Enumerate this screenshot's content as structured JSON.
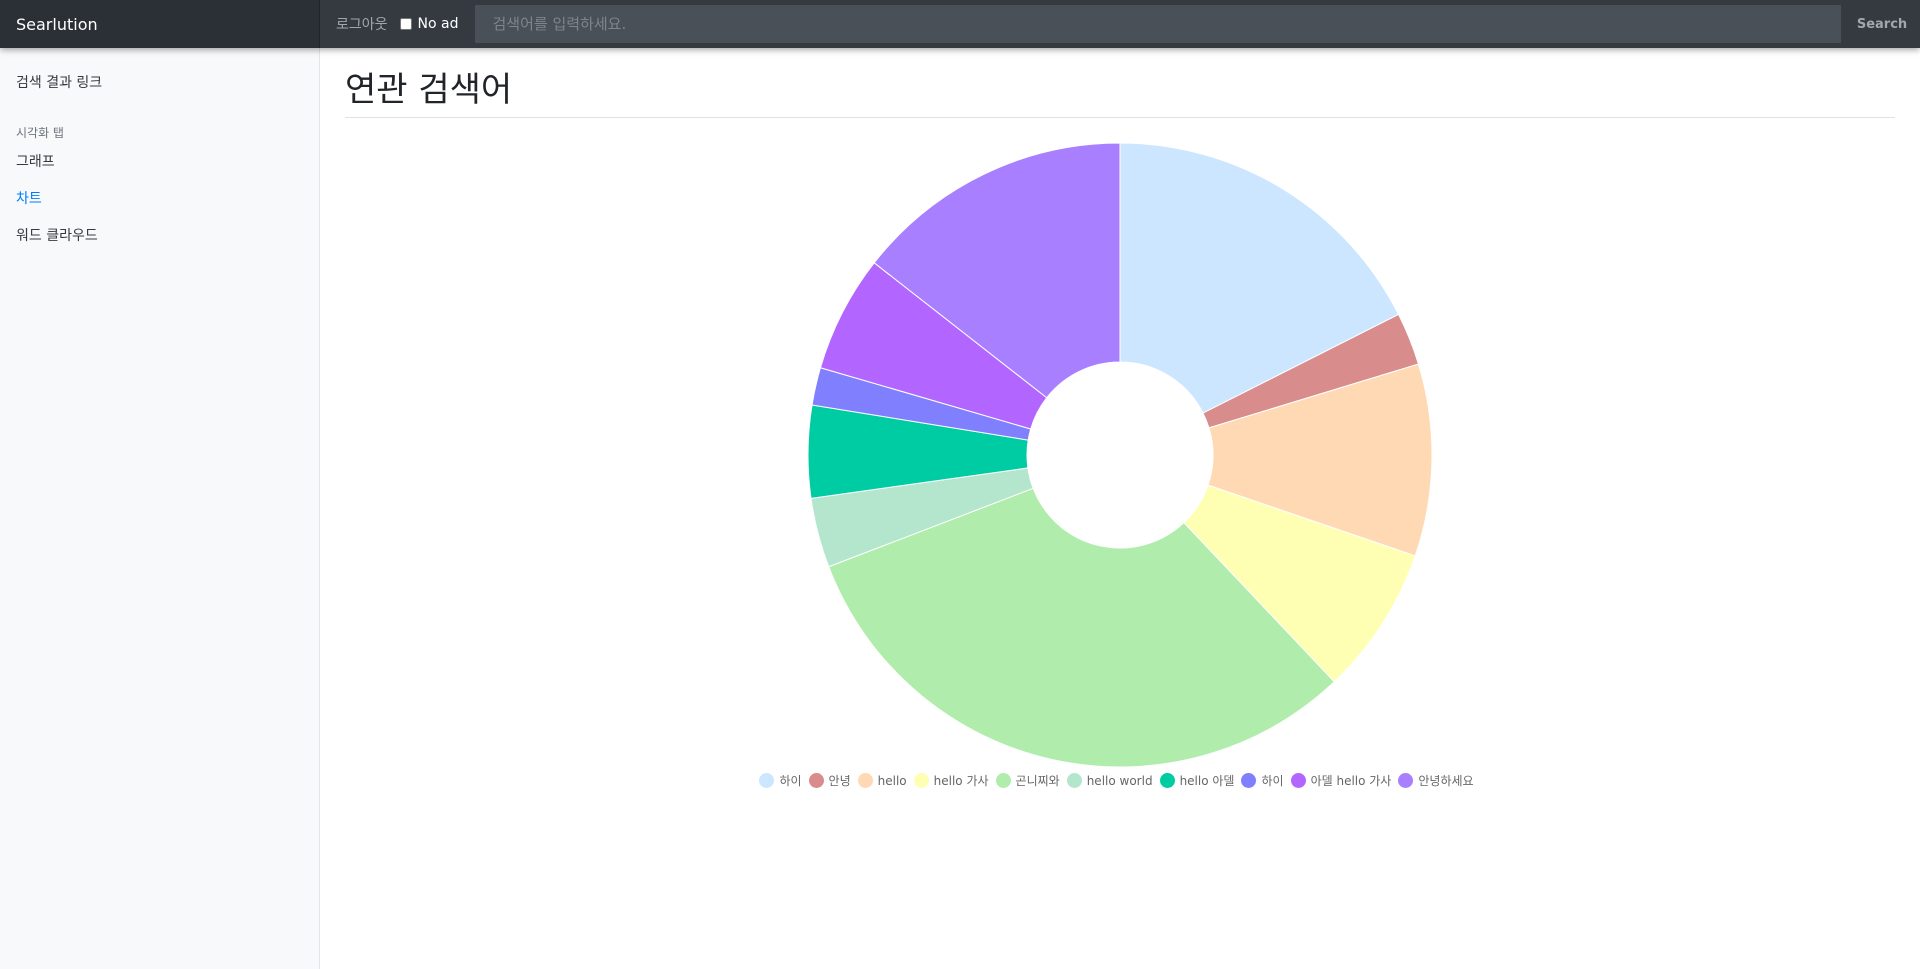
{
  "navbar": {
    "brand": "Searlution",
    "logout_label": "로그아웃",
    "noad_label": "No ad",
    "search_placeholder": "검색어를 입력하세요.",
    "search_button": "Search"
  },
  "sidebar": {
    "results_link": "검색 결과 링크",
    "viz_heading": "시각화 탭",
    "items": [
      {
        "label": "그래프",
        "active": false
      },
      {
        "label": "차트",
        "active": true
      },
      {
        "label": "워드 클라우드",
        "active": false
      }
    ]
  },
  "main": {
    "title": "연관 검색어"
  },
  "chart_data": {
    "type": "pie",
    "variant": "doughnut",
    "title": "",
    "legend_position": "bottom",
    "categories": [
      "하이",
      "안녕",
      "hello",
      "hello 가사",
      "곤니찌와",
      "hello world",
      "hello 아델",
      "하이",
      "아델 hello 가사",
      "안녕하세요"
    ],
    "values": [
      18,
      2.8,
      10.2,
      7.9,
      32,
      3.7,
      4.9,
      2,
      6.2,
      14.8
    ],
    "colors": [
      "#cce6ff",
      "#d98c8c",
      "#ffd9b3",
      "#ffffb3",
      "#b0edac",
      "#b3e6cc",
      "#00cca3",
      "#8080ff",
      "#b366ff",
      "#a880ff"
    ]
  }
}
